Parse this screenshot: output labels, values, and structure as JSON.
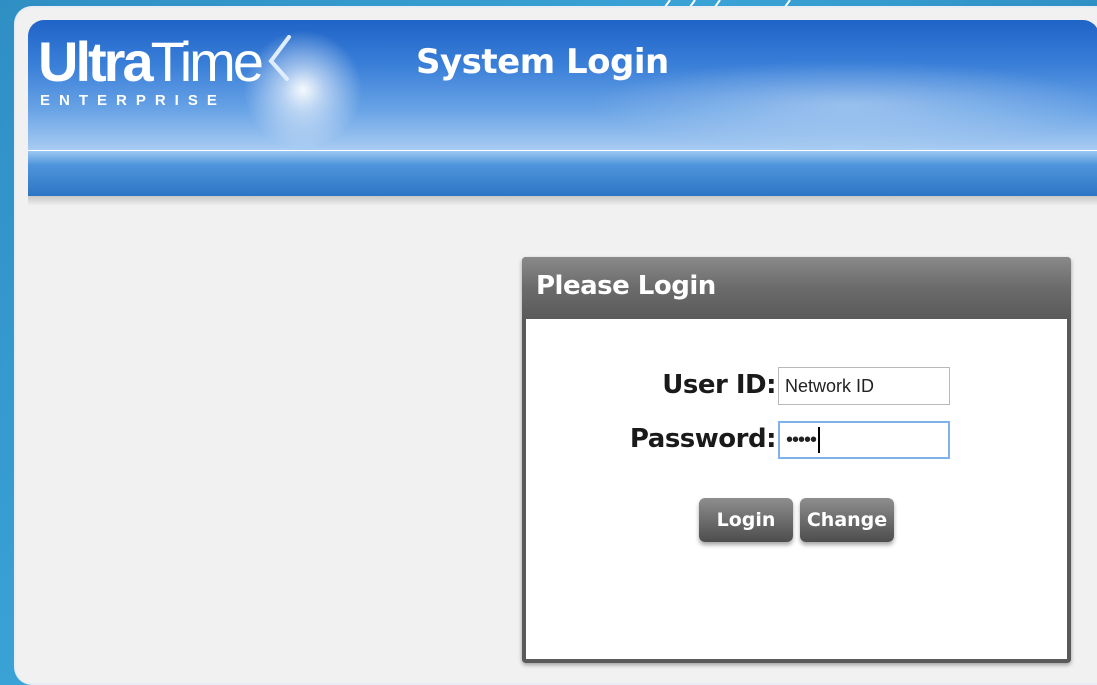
{
  "app": {
    "logo_primary_bold": "Ultra",
    "logo_primary_light": "Time",
    "logo_secondary": "ENTERPRISE",
    "page_title": "System Login"
  },
  "login_panel": {
    "title": "Please Login",
    "user_id_label": "User ID:",
    "user_id_value": "Network ID",
    "password_label": "Password:",
    "password_value_masked": "•••••",
    "login_button": "Login",
    "change_button": "Change"
  },
  "colors": {
    "banner_blue": "#1f64c7",
    "nav_blue": "#2d74c4",
    "panel_header_gray": "#6b6b6b",
    "button_gray": "#6a6a6a",
    "page_background": "#f1f1f1"
  },
  "icons": [
    "logo-swoosh-icon"
  ]
}
